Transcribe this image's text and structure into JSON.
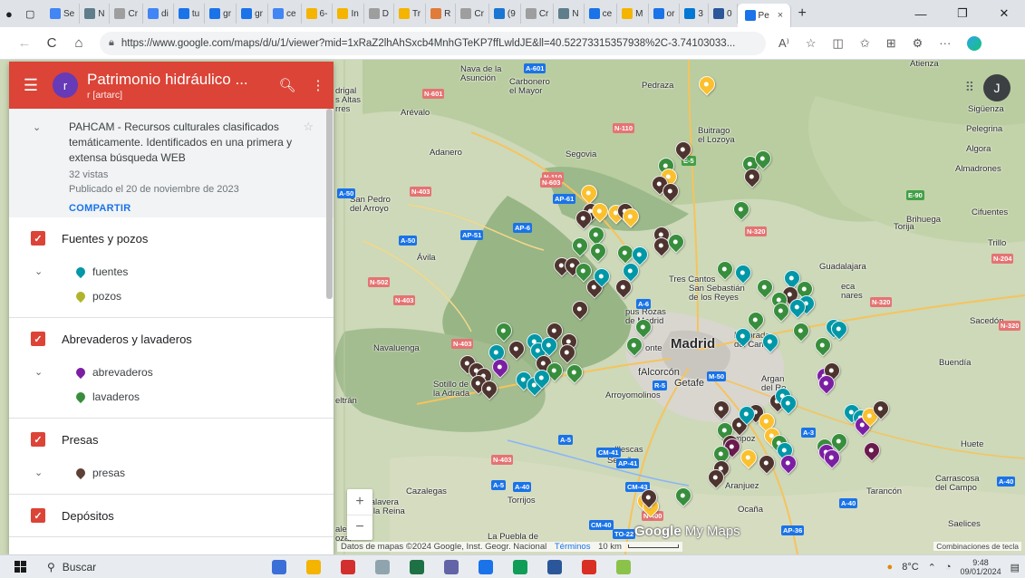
{
  "browser": {
    "tabs": [
      {
        "label": "Se",
        "color": "#4285f4"
      },
      {
        "label": "N",
        "color": "#607d8b"
      },
      {
        "label": "Cr",
        "color": "#9e9e9e"
      },
      {
        "label": "di",
        "color": "#4285f4"
      },
      {
        "label": "tu",
        "color": "#1a73e8"
      },
      {
        "label": "gr",
        "color": "#1a73e8"
      },
      {
        "label": "gr",
        "color": "#1a73e8"
      },
      {
        "label": "ce",
        "color": "#4285f4"
      },
      {
        "label": "6-",
        "color": "#f4b400"
      },
      {
        "label": "In",
        "color": "#f4b400"
      },
      {
        "label": "D",
        "color": "#9e9e9e"
      },
      {
        "label": "Tr",
        "color": "#f4b400"
      },
      {
        "label": "R",
        "color": "#e07b39"
      },
      {
        "label": "Cr",
        "color": "#9e9e9e"
      },
      {
        "label": "(9",
        "color": "#1976d2"
      },
      {
        "label": "Cr",
        "color": "#9e9e9e"
      },
      {
        "label": "N",
        "color": "#607d8b"
      },
      {
        "label": "ce",
        "color": "#1a73e8"
      },
      {
        "label": "M",
        "color": "#f4b400"
      },
      {
        "label": "or",
        "color": "#1a73e8"
      },
      {
        "label": "3",
        "color": "#0078d4"
      },
      {
        "label": "0",
        "color": "#2b579a"
      }
    ],
    "active_tab": {
      "label": "Pe",
      "close": "×"
    },
    "new_tab": "+",
    "window_controls": {
      "minimize": "—",
      "restore": "❐",
      "close": "✕"
    },
    "url": "https://www.google.com/maps/d/u/1/viewer?mid=1xRaZ2lhAhSxcb4MnhGTeKP7ffLwldJE&ll=40.52273315357938%2C-3.74103033...",
    "nav": {
      "back": "←",
      "reload": "C",
      "home": "⌂"
    },
    "url_icons": {
      "read_aloud": "A⁾",
      "favorite": "☆",
      "split": "◫",
      "favorites": "✩",
      "collections": "⊞",
      "extensions": "⚙",
      "more": "···"
    }
  },
  "panel": {
    "title": "Patrimonio hidráulico ...",
    "owner": "r [artarc]",
    "avatar_letter": "r",
    "description": "PAHCAM - Recursos culturales clasificados temáticamente. Identificados en una primera y extensa búsqueda WEB",
    "views": "32 vistas",
    "published": "Publicado el 20 de noviembre de 2023",
    "share": "COMPARTIR",
    "layers": [
      {
        "title": "Fuentes y pozos",
        "items": [
          {
            "label": "fuentes",
            "color": "#0097a7"
          },
          {
            "label": "pozos",
            "color": "#afb42b"
          }
        ]
      },
      {
        "title": "Abrevaderos y lavaderos",
        "items": [
          {
            "label": "abrevaderos",
            "color": "#7b1fa2"
          },
          {
            "label": "lavaderos",
            "color": "#388e3c"
          }
        ]
      },
      {
        "title": "Presas",
        "items": [
          {
            "label": "presas",
            "color": "#5d4037"
          }
        ]
      },
      {
        "title": "Depósitos",
        "items": []
      }
    ]
  },
  "map": {
    "account_letter": "J",
    "apps_icon": "⠿",
    "zoom_in": "+",
    "zoom_out": "−",
    "logo_google": "Google",
    "logo_mymaps": "My Maps",
    "attribution": "Datos de mapas ©2024 Google, Inst. Geogr. Nacional",
    "terms": "Términos",
    "scale": "10 km",
    "layer_toggle": "Combinaciones de tecla",
    "places": [
      {
        "id": "madrid",
        "text": "Madrid",
        "size": "big"
      },
      {
        "id": "getafe",
        "text": "Getafe",
        "size": "mid"
      },
      {
        "id": "alcorcon",
        "text": "fAlcorcón",
        "size": "mid"
      },
      {
        "id": "segovia",
        "text": "Segovia",
        "size": ""
      },
      {
        "id": "avila",
        "text": "Ávila",
        "size": ""
      },
      {
        "id": "guadalajara",
        "text": "Guadalajara",
        "size": ""
      },
      {
        "id": "arevalo",
        "text": "Arévalo",
        "size": ""
      },
      {
        "id": "adanero",
        "text": "Adanero",
        "size": ""
      },
      {
        "id": "nava",
        "text": "Nava de la\nAsunción",
        "size": ""
      },
      {
        "id": "carbonero",
        "text": "Carbonero\nel Mayor",
        "size": ""
      },
      {
        "id": "pedraza",
        "text": "Pedraza",
        "size": ""
      },
      {
        "id": "buitrago",
        "text": "Buitrago\nel Lozoya",
        "size": ""
      },
      {
        "id": "sanpedro",
        "text": "San Pedro\ndel Arroyo",
        "size": ""
      },
      {
        "id": "madrigal",
        "text": "drigal\ns Altas\nrres",
        "size": ""
      },
      {
        "id": "tres",
        "text": "Tres Cantos",
        "size": ""
      },
      {
        "id": "sanse",
        "text": "San Sebastián\nde los Reyes",
        "size": ""
      },
      {
        "id": "rozas",
        "text": "pus Rozas\nde Madrid",
        "size": ""
      },
      {
        "id": "monte",
        "text": "onte",
        "size": ""
      },
      {
        "id": "meco",
        "text": "eca\nnares",
        "size": ""
      },
      {
        "id": "torija",
        "text": "Torija",
        "size": ""
      },
      {
        "id": "brihuega",
        "text": "Brihuega",
        "size": ""
      },
      {
        "id": "cifuentes",
        "text": "Cifuentes",
        "size": ""
      },
      {
        "id": "trillo",
        "text": "Trillo",
        "size": ""
      },
      {
        "id": "siguenza",
        "text": "Sigüenza",
        "size": ""
      },
      {
        "id": "pelegrina",
        "text": "Pelegrina",
        "size": ""
      },
      {
        "id": "algora",
        "text": "Algora",
        "size": ""
      },
      {
        "id": "almadrones",
        "text": "Almadrones",
        "size": ""
      },
      {
        "id": "atienza",
        "text": "Atienza",
        "size": ""
      },
      {
        "id": "sacedon",
        "text": "Sacedón",
        "size": ""
      },
      {
        "id": "buendia",
        "text": "Buendía",
        "size": ""
      },
      {
        "id": "huete",
        "text": "Huete",
        "size": ""
      },
      {
        "id": "carrascosa",
        "text": "Carrascosa\ndel Campo",
        "size": ""
      },
      {
        "id": "saelices",
        "text": "Saelices",
        "size": ""
      },
      {
        "id": "tarancon",
        "text": "Tarancón",
        "size": ""
      },
      {
        "id": "ocana",
        "text": "Ocaña",
        "size": ""
      },
      {
        "id": "aranjuez",
        "text": "Aranjuez",
        "size": ""
      },
      {
        "id": "cienpoz",
        "text": "Ciempoz",
        "size": ""
      },
      {
        "id": "illescas",
        "text": "Illescas",
        "size": ""
      },
      {
        "id": "sesena",
        "text": "Seseña",
        "size": ""
      },
      {
        "id": "torrijos",
        "text": "Torrijos",
        "size": ""
      },
      {
        "id": "cazalegas",
        "text": "Cazalegas",
        "size": ""
      },
      {
        "id": "talavera",
        "text": "Talavera\ne la Reina",
        "size": ""
      },
      {
        "id": "puebla",
        "text": "La Puebla de",
        "size": ""
      },
      {
        "id": "arroyo",
        "text": "Arroyomolinos",
        "size": ""
      },
      {
        "id": "navaluenga",
        "text": "Navaluenga",
        "size": ""
      },
      {
        "id": "sotillo",
        "text": "Sotillo de\nla Adrada",
        "size": ""
      },
      {
        "id": "eltran",
        "text": "eltrán",
        "size": ""
      },
      {
        "id": "argan",
        "text": "Argan\ndel Re",
        "size": ""
      },
      {
        "id": "mejorada",
        "text": "Mejorada\ndel Campo",
        "size": ""
      },
      {
        "id": "ale",
        "text": "ale\nozar",
        "size": ""
      }
    ],
    "roads": [
      {
        "id": "a601",
        "text": "A-601",
        "color": "#1a73e8"
      },
      {
        "id": "n601",
        "text": "N-601",
        "color": "#e57373"
      },
      {
        "id": "n110a",
        "text": "N-110",
        "color": "#e57373"
      },
      {
        "id": "e5",
        "text": "E-5",
        "color": "#43a047"
      },
      {
        "id": "a50",
        "text": "A-50",
        "color": "#1a73e8"
      },
      {
        "id": "n403a",
        "text": "N-403",
        "color": "#e57373"
      },
      {
        "id": "n110b",
        "text": "N-110",
        "color": "#e57373"
      },
      {
        "id": "ap61",
        "text": "AP-61",
        "color": "#1a73e8"
      },
      {
        "id": "n603",
        "text": "N-603",
        "color": "#e57373"
      },
      {
        "id": "ap6",
        "text": "AP-6",
        "color": "#1a73e8"
      },
      {
        "id": "ap51",
        "text": "AP-51",
        "color": "#1a73e8"
      },
      {
        "id": "a50b",
        "text": "A-50",
        "color": "#1a73e8"
      },
      {
        "id": "n502",
        "text": "N-502",
        "color": "#e57373"
      },
      {
        "id": "n403b",
        "text": "N-403",
        "color": "#e57373"
      },
      {
        "id": "n403c",
        "text": "N-403",
        "color": "#e57373"
      },
      {
        "id": "a6",
        "text": "A-6",
        "color": "#1a73e8"
      },
      {
        "id": "m50",
        "text": "M-50",
        "color": "#1a73e8"
      },
      {
        "id": "r5",
        "text": "R-5",
        "color": "#1a73e8"
      },
      {
        "id": "a3",
        "text": "A-3",
        "color": "#1a73e8"
      },
      {
        "id": "e90",
        "text": "E-90",
        "color": "#43a047"
      },
      {
        "id": "n204",
        "text": "N-204",
        "color": "#e57373"
      },
      {
        "id": "n320a",
        "text": "N-320",
        "color": "#e57373"
      },
      {
        "id": "n320b",
        "text": "N-320",
        "color": "#e57373"
      },
      {
        "id": "a5",
        "text": "A-5",
        "color": "#1a73e8"
      },
      {
        "id": "cm41",
        "text": "CM-41",
        "color": "#1a73e8"
      },
      {
        "id": "n403d",
        "text": "N-403",
        "color": "#e57373"
      },
      {
        "id": "ap41",
        "text": "AP-41",
        "color": "#1a73e8"
      },
      {
        "id": "a40",
        "text": "A-40",
        "color": "#1a73e8"
      },
      {
        "id": "a5b",
        "text": "A-5",
        "color": "#1a73e8"
      },
      {
        "id": "cm43",
        "text": "CM-43",
        "color": "#1a73e8"
      },
      {
        "id": "n400",
        "text": "N-400",
        "color": "#e57373"
      },
      {
        "id": "cm40",
        "text": "CM-40",
        "color": "#1a73e8"
      },
      {
        "id": "to22",
        "text": "TO-22",
        "color": "#1a73e8"
      },
      {
        "id": "ap36",
        "text": "AP-36",
        "color": "#1a73e8"
      },
      {
        "id": "a40b",
        "text": "A-40",
        "color": "#1a73e8"
      },
      {
        "id": "a40c",
        "text": "A-40",
        "color": "#1a73e8"
      },
      {
        "id": "n320c",
        "text": "N-320",
        "color": "#e57373"
      }
    ]
  },
  "taskbar": {
    "search": "Buscar",
    "weather": "8°C",
    "time": "9:48",
    "date": "09/01/2024",
    "icons": [
      "#3b6fd8",
      "#f4b400",
      "#d32f2f",
      "#90a4ae",
      "#1e7145",
      "#6264a7",
      "#1a73e8",
      "#0f9d58",
      "#2b579a",
      "#d93025",
      "#8bc34a"
    ]
  }
}
